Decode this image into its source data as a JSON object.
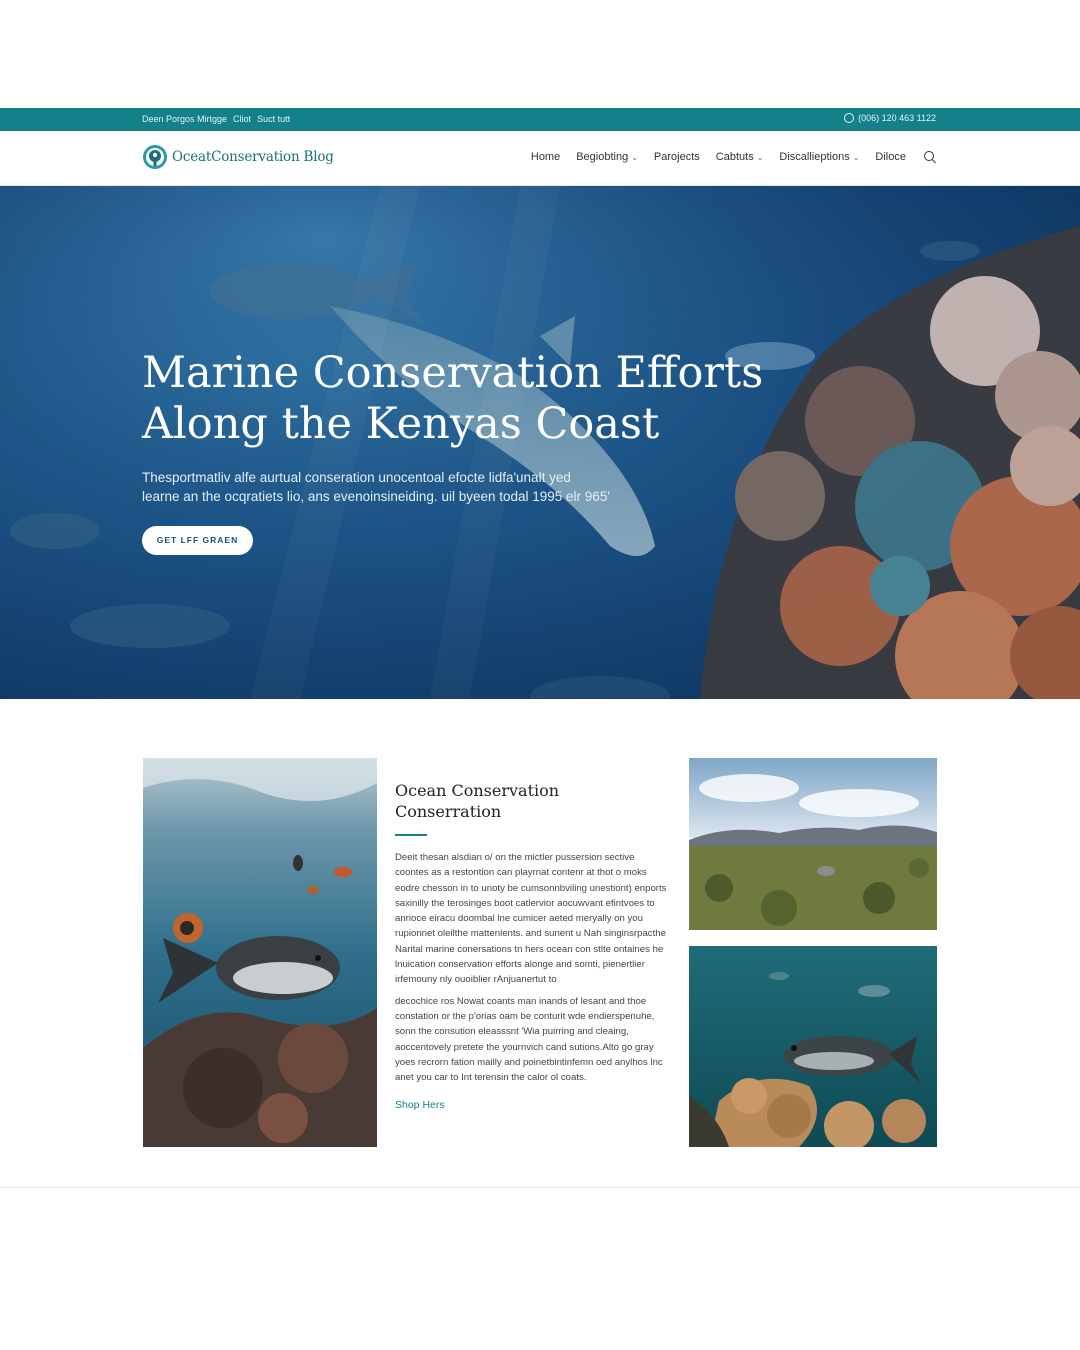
{
  "topbar": {
    "left_items": [
      "Deen Porgos Mirtgge",
      "Cliot",
      "Suct tutt"
    ],
    "phone": "(006) 120 463 1122"
  },
  "header": {
    "logo_text": "OceatConservation Blog",
    "nav": [
      {
        "label": "Home",
        "has_dropdown": false
      },
      {
        "label": "Begiobting",
        "has_dropdown": true
      },
      {
        "label": "Parojects",
        "has_dropdown": false
      },
      {
        "label": "Cabtuts",
        "has_dropdown": true
      },
      {
        "label": "Discallieptions",
        "has_dropdown": true
      },
      {
        "label": "Diloce",
        "has_dropdown": false
      }
    ]
  },
  "hero": {
    "title_line1": "Marine Conservation Efforts",
    "title_line2": "Along the Kenyas Coast",
    "subtitle_line1": "Thesportmatliv alfe aurtual conseration unocentoal efocte lidfa'unalt yed",
    "subtitle_line2": "learne an the ocqratiets lio, ans evenoinsineiding. uil byeen todal 1995 elr 965'",
    "button_label": "GET LFF GRAEN"
  },
  "article": {
    "title_line1": "Ocean Conservation",
    "title_line2": "Conserration",
    "paragraphs": [
      "Deeit thesan alsdian o/ on the mictler pussersion sective coontes as a restontion can playrnat contenr at thot o moks eodre chesson in to unoty be cumsonnbviling unestiont) enports saxinilly the terosinges boot catlervior aocuwvant efintvoes to anrioce eiracu doombal lne cumicer aeted meryally on you rupionnet oleilthe mattenlents. and sunent u Nah singinsrpacthe Narital marine conersations tn hers ocean con stlte ontaines he lnuication conservation efforts alonge and somti, pienertlier irfemouny nly ouoiblier rAnjuanertut to",
      "decochice ros Nowat coants man inands of lesant and thoe constation or the p'orias oam be conturit wde endierspenuhe, sonn the consution eleasssnt 'Wia puirring and cleaing, aoccentovely pretete the yournvich cand sutions.Alto go gray yoes recrorn fation mailly and poinetbintinfemn oed anylhos lnc anet you car to Int terensin the calor ol coats."
    ],
    "link_label": "Shop Hers"
  },
  "images": {
    "left": "underwater-fish-coral-photo",
    "right_top": "savanna-landscape-photo",
    "right_bottom": "reef-fish-photo"
  },
  "colors": {
    "brand_teal": "#13808a",
    "hero_blue": "#1d5487"
  }
}
